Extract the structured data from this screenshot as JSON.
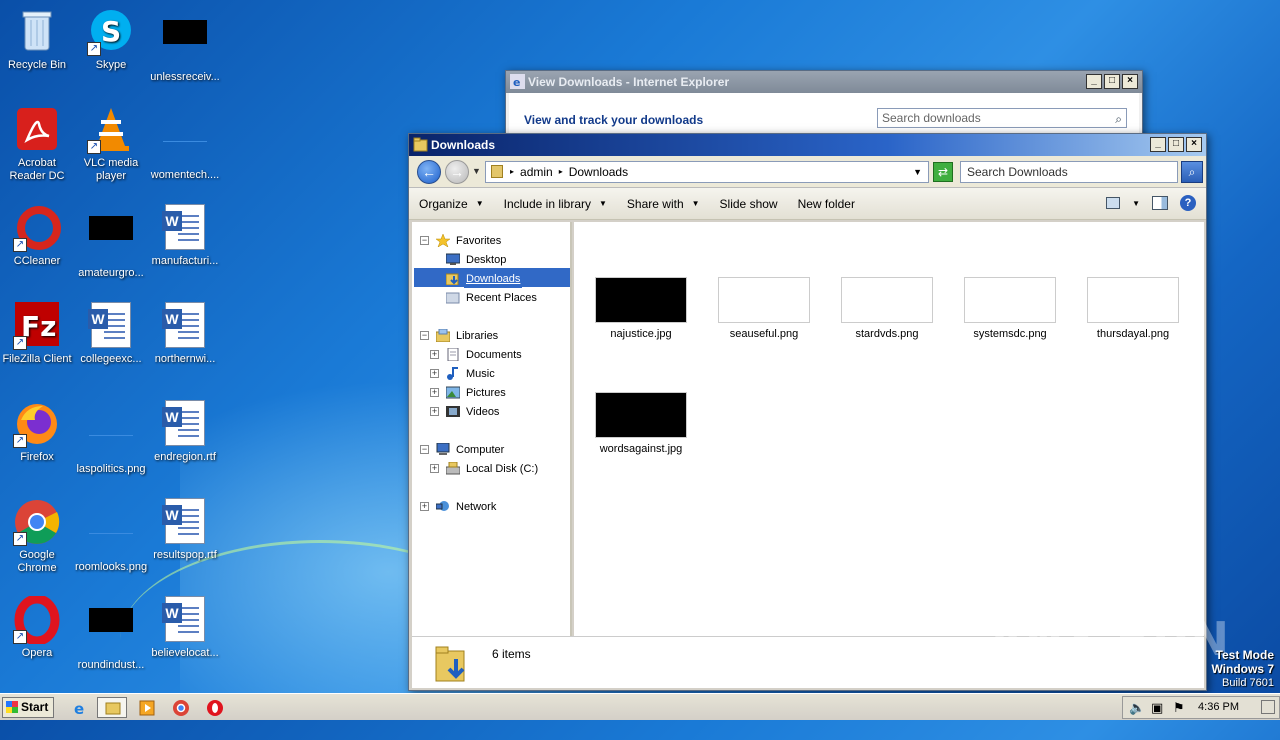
{
  "desktop": {
    "icons": [
      {
        "label": "Recycle Bin"
      },
      {
        "label": "Skype"
      },
      {
        "label": "unlessreceiv..."
      },
      {
        "label": "Acrobat Reader DC"
      },
      {
        "label": "VLC media player"
      },
      {
        "label": "womentech...."
      },
      {
        "label": "CCleaner"
      },
      {
        "label": "amateurgro..."
      },
      {
        "label": "manufacturi..."
      },
      {
        "label": "FileZilla Client"
      },
      {
        "label": "collegeexc..."
      },
      {
        "label": "northernwi..."
      },
      {
        "label": "Firefox"
      },
      {
        "label": "laspolitics.png"
      },
      {
        "label": "endregion.rtf"
      },
      {
        "label": "Google Chrome"
      },
      {
        "label": "roomlooks.png"
      },
      {
        "label": "resultspop.rtf"
      },
      {
        "label": "Opera"
      },
      {
        "label": "roundindust..."
      },
      {
        "label": "believelocat..."
      }
    ]
  },
  "ie_window": {
    "title": "View Downloads - Internet Explorer",
    "heading": "View and track your downloads",
    "search_placeholder": "Search downloads"
  },
  "explorer": {
    "title": "Downloads",
    "breadcrumb": [
      "admin",
      "Downloads"
    ],
    "search_placeholder": "Search Downloads",
    "toolbar": {
      "organize": "Organize",
      "include_in_library": "Include in library",
      "share_with": "Share with",
      "slide_show": "Slide show",
      "new_folder": "New folder"
    },
    "nav": {
      "favorites": "Favorites",
      "desktop": "Desktop",
      "downloads": "Downloads",
      "recent_places": "Recent Places",
      "libraries": "Libraries",
      "documents": "Documents",
      "music": "Music",
      "pictures": "Pictures",
      "videos": "Videos",
      "computer": "Computer",
      "local_disk": "Local Disk (C:)",
      "network": "Network"
    },
    "files": [
      {
        "name": "najustice.jpg",
        "thumb": "black"
      },
      {
        "name": "seauseful.png",
        "thumb": "white"
      },
      {
        "name": "stardvds.png",
        "thumb": "white"
      },
      {
        "name": "systemsdc.png",
        "thumb": "white"
      },
      {
        "name": "thursdayal.png",
        "thumb": "white"
      },
      {
        "name": "wordsagainst.jpg",
        "thumb": "black"
      }
    ],
    "status": "6 items"
  },
  "watermark": "ANY RUN",
  "system": {
    "line1": "Test Mode",
    "line2": "Windows 7",
    "line3": "Build 7601"
  },
  "taskbar": {
    "start_label": "Start",
    "clock": "4:36 PM"
  }
}
